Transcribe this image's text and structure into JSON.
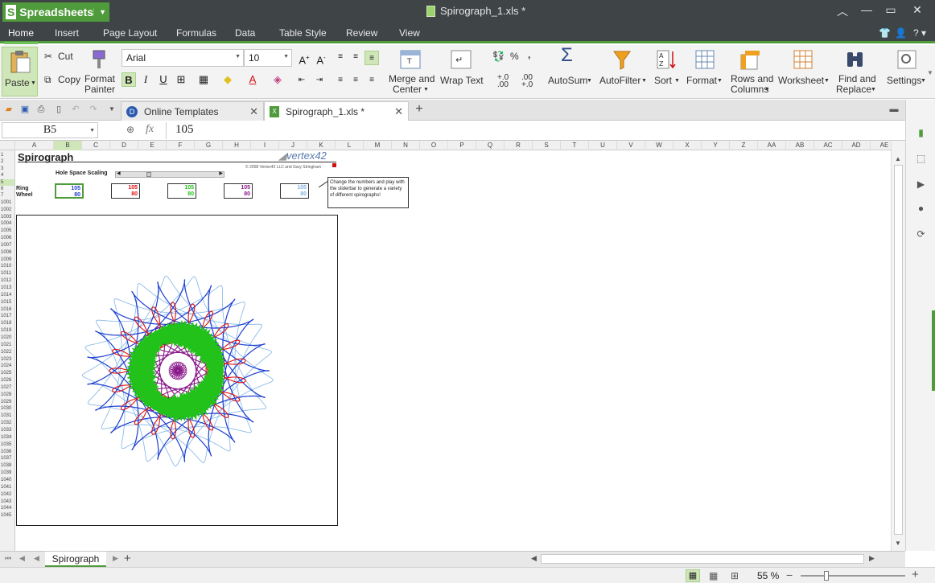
{
  "app": {
    "name": "Spreadsheets",
    "window_title": "Spirograph_1.xls *"
  },
  "menu": {
    "tabs": [
      "Home",
      "Insert",
      "Page Layout",
      "Formulas",
      "Data",
      "Table Style",
      "Review",
      "View"
    ]
  },
  "ribbon": {
    "paste": "Paste",
    "cut": "Cut",
    "copy": "Copy",
    "format_painter_1": "Format",
    "format_painter_2": "Painter",
    "font_name": "Arial",
    "font_size": "10",
    "merge_1": "Merge and",
    "merge_2": "Center",
    "wrap_text": "Wrap Text",
    "percent": "%",
    "comma": ",",
    "dec_inc": "+.0\n.00",
    "dec_dec": ".00\n+.0",
    "autosum": "AutoSum",
    "autofilter": "AutoFilter",
    "sort": "Sort",
    "format": "Format",
    "rows_cols_1": "Rows and",
    "rows_cols_2": "Columns",
    "worksheet": "Worksheet",
    "find_1": "Find and",
    "find_2": "Replace",
    "settings": "Settings"
  },
  "doc_tabs": [
    {
      "label": "Online Templates"
    },
    {
      "label": "Spirograph_1.xls *"
    }
  ],
  "formula_bar": {
    "cell_ref": "B5",
    "fx": "fx",
    "value": "105"
  },
  "columns": [
    "A",
    "B",
    "C",
    "D",
    "E",
    "F",
    "G",
    "H",
    "I",
    "J",
    "K",
    "L",
    "M",
    "N",
    "O",
    "P",
    "Q",
    "R",
    "S",
    "T",
    "U",
    "V",
    "W",
    "X",
    "Y",
    "Z",
    "AA",
    "AB",
    "AC",
    "AD",
    "AE"
  ],
  "rows_top": [
    "1",
    "2",
    "3",
    "4",
    "5",
    "6",
    "7"
  ],
  "rows_bottom_start": 1001,
  "rows_bottom_end": 1045,
  "sheet": {
    "title": "Spirograph",
    "brand": "vertex42",
    "copyright": "© 2008 Vertex42 LLC and Gary Stringham",
    "hole_space_scaling": "Hole Space Scaling",
    "ring_label": "Ring",
    "wheel_label": "Wheel",
    "inputs": [
      {
        "ring": "105",
        "wheel": "80",
        "color": "#1d3fd0"
      },
      {
        "ring": "105",
        "wheel": "80",
        "color": "#e01010"
      },
      {
        "ring": "105",
        "wheel": "80",
        "color": "#22c21a"
      },
      {
        "ring": "105",
        "wheel": "80",
        "color": "#8a1a8a"
      },
      {
        "ring": "105",
        "wheel": "80",
        "color": "#7fb4e6"
      }
    ],
    "note": "Change the numbers and play with the sliderbar to generate a variety of different spirographs!"
  },
  "sheet_tabs": [
    "Spirograph"
  ],
  "status": {
    "zoom": "55 %"
  }
}
